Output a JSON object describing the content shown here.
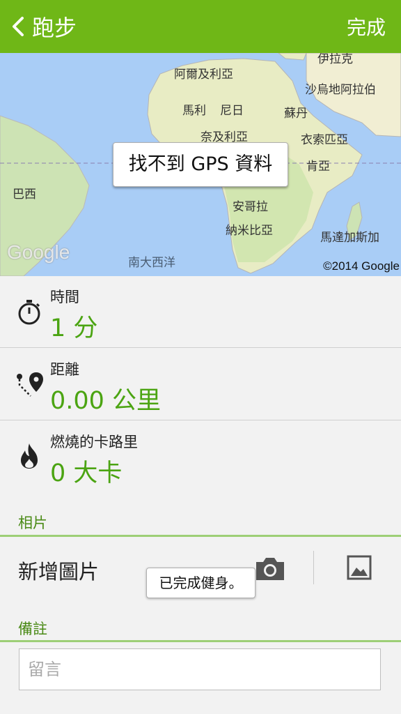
{
  "header": {
    "title": "跑步",
    "done_label": "完成",
    "back_icon": "chevron-left-icon",
    "background": "#6fb717"
  },
  "map": {
    "labels": {
      "iraq": "伊拉克",
      "algeria": "阿爾及利亞",
      "saudi": "沙烏地阿拉伯",
      "mali": "馬利",
      "niger": "尼日",
      "sudan": "蘇丹",
      "nigeria": "奈及利亞",
      "ethiopia": "衣索匹亞",
      "kenya": "肯亞",
      "brazil": "巴西",
      "angola": "安哥拉",
      "namibia": "納米比亞",
      "madagascar": "馬達加斯加",
      "south_atlantic": "南大西洋"
    },
    "gps_message": "找不到 GPS 資料",
    "google_logo": "Google",
    "copyright": "©2014 Google"
  },
  "stats": {
    "time": {
      "label": "時間",
      "value": "1 分",
      "icon": "stopwatch-icon"
    },
    "distance": {
      "label": "距離",
      "value": "0.00 公里",
      "icon": "route-pin-icon"
    },
    "calories": {
      "label": "燃燒的卡路里",
      "value": "0 大卡",
      "icon": "flame-icon"
    },
    "value_color": "#4ba412"
  },
  "photos": {
    "section_title": "相片",
    "add_label": "新增圖片",
    "camera_icon": "camera-icon",
    "gallery_icon": "gallery-icon"
  },
  "toast": "已完成健身。",
  "notes": {
    "section_title": "備註",
    "placeholder": "留言",
    "value": ""
  }
}
